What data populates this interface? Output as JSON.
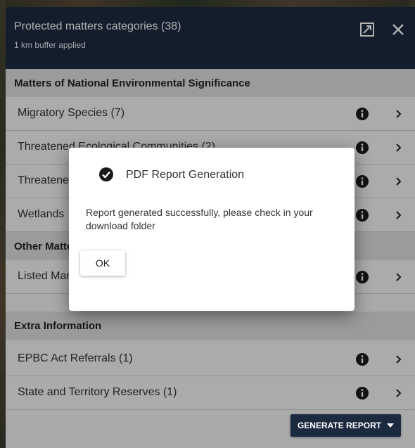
{
  "header": {
    "title": "Protected matters categories (38)",
    "subtitle": "1 km buffer applied",
    "expand_icon": "expand-icon",
    "close_icon": "close-icon"
  },
  "sections": [
    {
      "title": "Matters of National Environmental Significance",
      "items": [
        {
          "label": "Migratory Species (7)"
        },
        {
          "label": "Threatened Ecological Communities (2)"
        },
        {
          "label": "Threatened Species"
        },
        {
          "label": "Wetlands"
        }
      ]
    },
    {
      "title": "Other Matters",
      "items": [
        {
          "label": "Listed Marine Species"
        }
      ]
    },
    {
      "title": "Extra Information",
      "items": [
        {
          "label": "EPBC Act Referrals (1)"
        },
        {
          "label": "State and Territory Reserves (1)"
        }
      ]
    }
  ],
  "footer": {
    "generate_label": "GENERATE REPORT"
  },
  "dialog": {
    "title": "PDF Report Generation",
    "message": "Report generated successfully, please check in your download folder",
    "ok_label": "OK",
    "icon": "check-circle-icon"
  },
  "colors": {
    "header_bg": "#1c2a40",
    "section_bg": "#dedede",
    "row_bg": "#f5f5f5",
    "overlay": "rgba(0,0,0,0.3)"
  }
}
